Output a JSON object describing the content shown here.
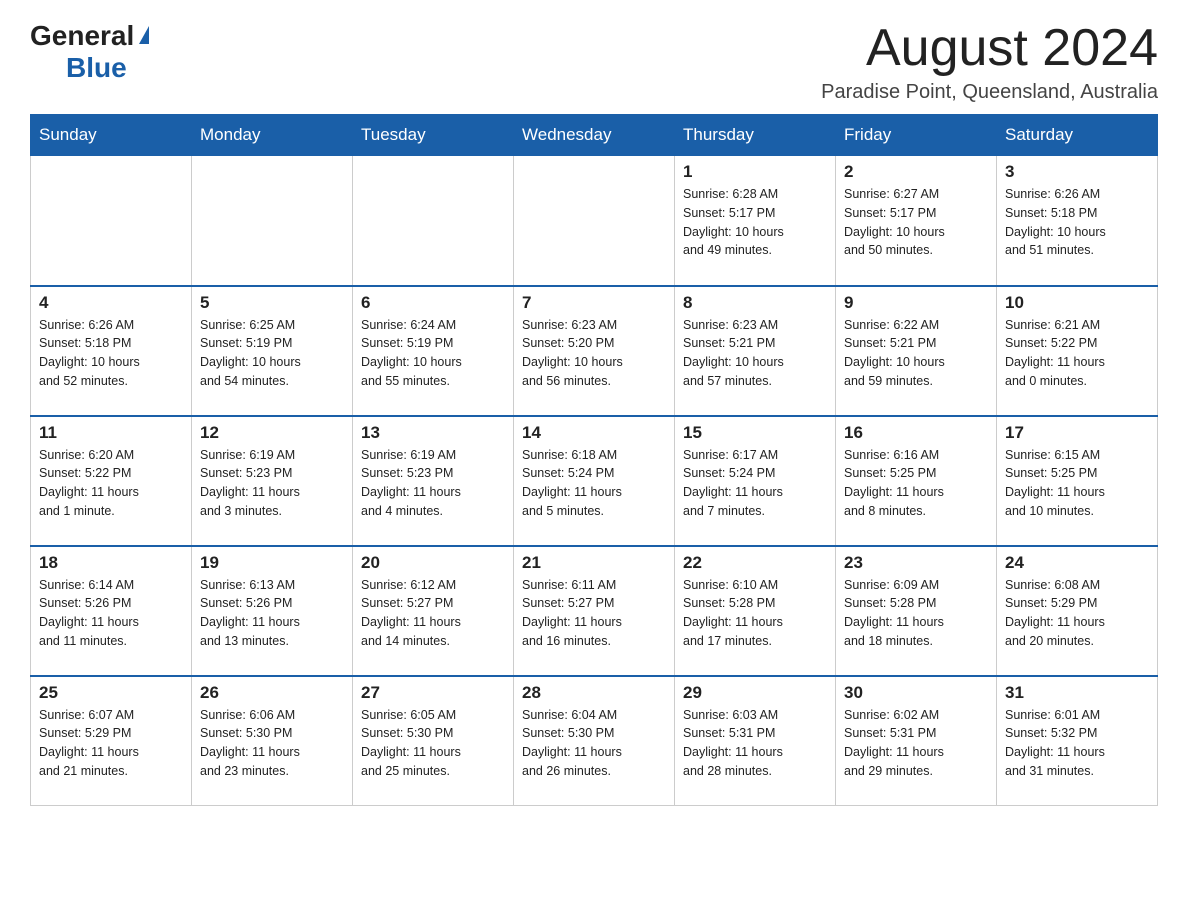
{
  "header": {
    "logo": {
      "general": "General",
      "triangle": "▶",
      "blue": "Blue"
    },
    "title": "August 2024",
    "location": "Paradise Point, Queensland, Australia"
  },
  "days_of_week": [
    "Sunday",
    "Monday",
    "Tuesday",
    "Wednesday",
    "Thursday",
    "Friday",
    "Saturday"
  ],
  "weeks": [
    [
      {
        "day": "",
        "info": ""
      },
      {
        "day": "",
        "info": ""
      },
      {
        "day": "",
        "info": ""
      },
      {
        "day": "",
        "info": ""
      },
      {
        "day": "1",
        "info": "Sunrise: 6:28 AM\nSunset: 5:17 PM\nDaylight: 10 hours\nand 49 minutes."
      },
      {
        "day": "2",
        "info": "Sunrise: 6:27 AM\nSunset: 5:17 PM\nDaylight: 10 hours\nand 50 minutes."
      },
      {
        "day": "3",
        "info": "Sunrise: 6:26 AM\nSunset: 5:18 PM\nDaylight: 10 hours\nand 51 minutes."
      }
    ],
    [
      {
        "day": "4",
        "info": "Sunrise: 6:26 AM\nSunset: 5:18 PM\nDaylight: 10 hours\nand 52 minutes."
      },
      {
        "day": "5",
        "info": "Sunrise: 6:25 AM\nSunset: 5:19 PM\nDaylight: 10 hours\nand 54 minutes."
      },
      {
        "day": "6",
        "info": "Sunrise: 6:24 AM\nSunset: 5:19 PM\nDaylight: 10 hours\nand 55 minutes."
      },
      {
        "day": "7",
        "info": "Sunrise: 6:23 AM\nSunset: 5:20 PM\nDaylight: 10 hours\nand 56 minutes."
      },
      {
        "day": "8",
        "info": "Sunrise: 6:23 AM\nSunset: 5:21 PM\nDaylight: 10 hours\nand 57 minutes."
      },
      {
        "day": "9",
        "info": "Sunrise: 6:22 AM\nSunset: 5:21 PM\nDaylight: 10 hours\nand 59 minutes."
      },
      {
        "day": "10",
        "info": "Sunrise: 6:21 AM\nSunset: 5:22 PM\nDaylight: 11 hours\nand 0 minutes."
      }
    ],
    [
      {
        "day": "11",
        "info": "Sunrise: 6:20 AM\nSunset: 5:22 PM\nDaylight: 11 hours\nand 1 minute."
      },
      {
        "day": "12",
        "info": "Sunrise: 6:19 AM\nSunset: 5:23 PM\nDaylight: 11 hours\nand 3 minutes."
      },
      {
        "day": "13",
        "info": "Sunrise: 6:19 AM\nSunset: 5:23 PM\nDaylight: 11 hours\nand 4 minutes."
      },
      {
        "day": "14",
        "info": "Sunrise: 6:18 AM\nSunset: 5:24 PM\nDaylight: 11 hours\nand 5 minutes."
      },
      {
        "day": "15",
        "info": "Sunrise: 6:17 AM\nSunset: 5:24 PM\nDaylight: 11 hours\nand 7 minutes."
      },
      {
        "day": "16",
        "info": "Sunrise: 6:16 AM\nSunset: 5:25 PM\nDaylight: 11 hours\nand 8 minutes."
      },
      {
        "day": "17",
        "info": "Sunrise: 6:15 AM\nSunset: 5:25 PM\nDaylight: 11 hours\nand 10 minutes."
      }
    ],
    [
      {
        "day": "18",
        "info": "Sunrise: 6:14 AM\nSunset: 5:26 PM\nDaylight: 11 hours\nand 11 minutes."
      },
      {
        "day": "19",
        "info": "Sunrise: 6:13 AM\nSunset: 5:26 PM\nDaylight: 11 hours\nand 13 minutes."
      },
      {
        "day": "20",
        "info": "Sunrise: 6:12 AM\nSunset: 5:27 PM\nDaylight: 11 hours\nand 14 minutes."
      },
      {
        "day": "21",
        "info": "Sunrise: 6:11 AM\nSunset: 5:27 PM\nDaylight: 11 hours\nand 16 minutes."
      },
      {
        "day": "22",
        "info": "Sunrise: 6:10 AM\nSunset: 5:28 PM\nDaylight: 11 hours\nand 17 minutes."
      },
      {
        "day": "23",
        "info": "Sunrise: 6:09 AM\nSunset: 5:28 PM\nDaylight: 11 hours\nand 18 minutes."
      },
      {
        "day": "24",
        "info": "Sunrise: 6:08 AM\nSunset: 5:29 PM\nDaylight: 11 hours\nand 20 minutes."
      }
    ],
    [
      {
        "day": "25",
        "info": "Sunrise: 6:07 AM\nSunset: 5:29 PM\nDaylight: 11 hours\nand 21 minutes."
      },
      {
        "day": "26",
        "info": "Sunrise: 6:06 AM\nSunset: 5:30 PM\nDaylight: 11 hours\nand 23 minutes."
      },
      {
        "day": "27",
        "info": "Sunrise: 6:05 AM\nSunset: 5:30 PM\nDaylight: 11 hours\nand 25 minutes."
      },
      {
        "day": "28",
        "info": "Sunrise: 6:04 AM\nSunset: 5:30 PM\nDaylight: 11 hours\nand 26 minutes."
      },
      {
        "day": "29",
        "info": "Sunrise: 6:03 AM\nSunset: 5:31 PM\nDaylight: 11 hours\nand 28 minutes."
      },
      {
        "day": "30",
        "info": "Sunrise: 6:02 AM\nSunset: 5:31 PM\nDaylight: 11 hours\nand 29 minutes."
      },
      {
        "day": "31",
        "info": "Sunrise: 6:01 AM\nSunset: 5:32 PM\nDaylight: 11 hours\nand 31 minutes."
      }
    ]
  ]
}
